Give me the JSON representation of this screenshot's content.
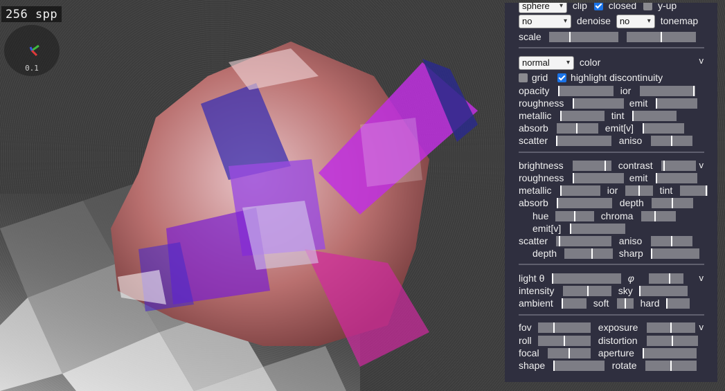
{
  "hud": {
    "spp": "256 spp",
    "gizmo_scale": "0.1"
  },
  "colors": {
    "panel_bg": "#2f2f3f",
    "slider_track": "#7d7d85",
    "checkbox_on": "#1a73e8"
  },
  "top": {
    "shape_select": "sphere",
    "clip_label": "clip",
    "closed_label": "closed",
    "closed_checked": true,
    "yup_label": "y-up",
    "yup_checked": false,
    "mode_select": "no",
    "denoise_label": "denoise",
    "denoise_select": "no",
    "tonemap_label": "tonemap",
    "scale_label": "scale",
    "scale_a": 0.3,
    "scale_b": 0.5
  },
  "material": {
    "view_select": "normal",
    "color_label": "color",
    "toggle": "v",
    "grid_label": "grid",
    "grid_checked": false,
    "highlight_label": "highlight discontinuity",
    "highlight_checked": true,
    "opacity_label": "opacity",
    "opacity": 0.0,
    "ior_label": "ior",
    "ior": 0.98,
    "roughness_label": "roughness",
    "roughness": 0.0,
    "emit_label": "emit",
    "emit": 0.0,
    "metallic_label": "metallic",
    "metallic": 0.0,
    "tint_label": "tint",
    "tint": 0.0,
    "absorb_label": "absorb",
    "absorb": 0.48,
    "emitv_label": "emit[v]",
    "emitv": 0.0,
    "scatter_label": "scatter",
    "scatter": 0.0,
    "aniso_label": "aniso",
    "aniso": 0.5
  },
  "layer": {
    "toggle": "v",
    "brightness_label": "brightness",
    "brightness": 0.85,
    "contrast_label": "contrast",
    "contrast": 0.08,
    "roughness_label": "roughness",
    "roughness": 0.0,
    "emit_label": "emit",
    "emit": 0.0,
    "metallic_label": "metallic",
    "metallic": 0.0,
    "ior_label": "ior",
    "ior": 0.5,
    "tint_label": "tint",
    "tint": 0.95,
    "absorb_label": "absorb",
    "absorb": 0.0,
    "depth_label": "depth",
    "depth": 0.5,
    "hue_label": "hue",
    "hue": 0.5,
    "chroma_label": "chroma",
    "chroma": 0.4,
    "emitv_label": "emit[v]",
    "emitv": 0.0,
    "scatter_label": "scatter",
    "scatter": 0.07,
    "aniso_label": "aniso",
    "aniso": 0.5,
    "depth2_label": "depth",
    "depth2": 0.58,
    "sharp_label": "sharp",
    "sharp": 0.0
  },
  "light": {
    "toggle": "v",
    "theta_label": "light θ",
    "theta": 0.0,
    "phi_label": "φ",
    "phi": 0.6,
    "intensity_label": "intensity",
    "intensity": 0.52,
    "sky_label": "sky",
    "sky": 0.0,
    "ambient_label": "ambient",
    "ambient": 0.0,
    "soft_label": "soft",
    "soft": 0.5,
    "hard_label": "hard",
    "hard": 0.0
  },
  "camera": {
    "toggle": "v",
    "fov_label": "fov",
    "fov": 0.3,
    "exposure_label": "exposure",
    "exposure": 0.5,
    "roll_label": "roll",
    "roll": 0.5,
    "distortion_label": "distortion",
    "distortion": 0.5,
    "focal_label": "focal",
    "focal": 0.5,
    "aperture_label": "aperture",
    "aperture": 0.0,
    "shape_label": "shape",
    "shape": 0.0,
    "rotate_label": "rotate",
    "rotate": 0.5
  }
}
